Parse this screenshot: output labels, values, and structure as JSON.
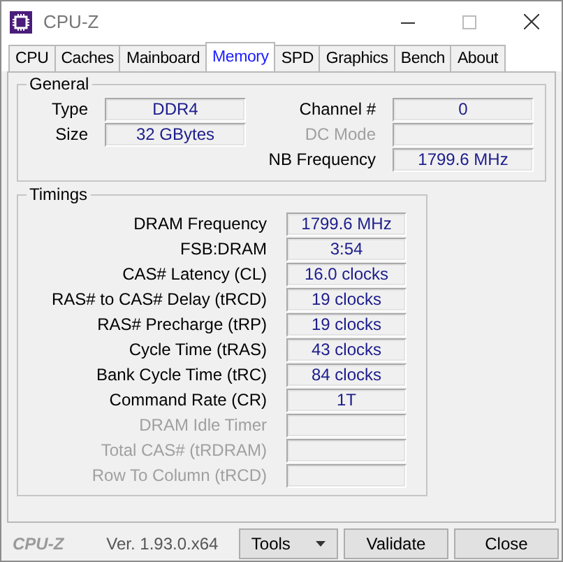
{
  "window": {
    "title": "CPU-Z"
  },
  "tabs": [
    {
      "label": "CPU",
      "selected": false
    },
    {
      "label": "Caches",
      "selected": false
    },
    {
      "label": "Mainboard",
      "selected": false
    },
    {
      "label": "Memory",
      "selected": true
    },
    {
      "label": "SPD",
      "selected": false
    },
    {
      "label": "Graphics",
      "selected": false
    },
    {
      "label": "Bench",
      "selected": false
    },
    {
      "label": "About",
      "selected": false
    }
  ],
  "general": {
    "title": "General",
    "left": [
      {
        "label": "Type",
        "value": "DDR4",
        "disabled": false
      },
      {
        "label": "Size",
        "value": "32 GBytes",
        "disabled": false
      }
    ],
    "right": [
      {
        "label": "Channel #",
        "value": "0",
        "disabled": false
      },
      {
        "label": "DC Mode",
        "disabled": true
      },
      {
        "label": "NB Frequency",
        "value": "1799.6 MHz",
        "disabled": false
      }
    ]
  },
  "timings": {
    "title": "Timings",
    "rows": [
      {
        "label": "DRAM Frequency",
        "value": "1799.6 MHz",
        "disabled": false
      },
      {
        "label": "FSB:DRAM",
        "value": "3:54",
        "disabled": false
      },
      {
        "label": "CAS# Latency (CL)",
        "value": "16.0 clocks",
        "disabled": false
      },
      {
        "label": "RAS# to CAS# Delay (tRCD)",
        "value": "19 clocks",
        "disabled": false
      },
      {
        "label": "RAS# Precharge (tRP)",
        "value": "19 clocks",
        "disabled": false
      },
      {
        "label": "Cycle Time (tRAS)",
        "value": "43 clocks",
        "disabled": false
      },
      {
        "label": "Bank Cycle Time (tRC)",
        "value": "84 clocks",
        "disabled": false
      },
      {
        "label": "Command Rate (CR)",
        "value": "1T",
        "disabled": false
      },
      {
        "label": "DRAM Idle Timer",
        "disabled": true
      },
      {
        "label": "Total CAS# (tRDRAM)",
        "disabled": true
      },
      {
        "label": "Row To Column (tRCD)",
        "disabled": true
      }
    ]
  },
  "footer": {
    "brand": "CPU-Z",
    "version": "Ver. 1.93.0.x64",
    "buttons": [
      {
        "label": "Tools",
        "kind": "dropdown"
      },
      {
        "label": "Validate",
        "kind": "plain"
      },
      {
        "label": "Close",
        "kind": "plain"
      }
    ]
  }
}
